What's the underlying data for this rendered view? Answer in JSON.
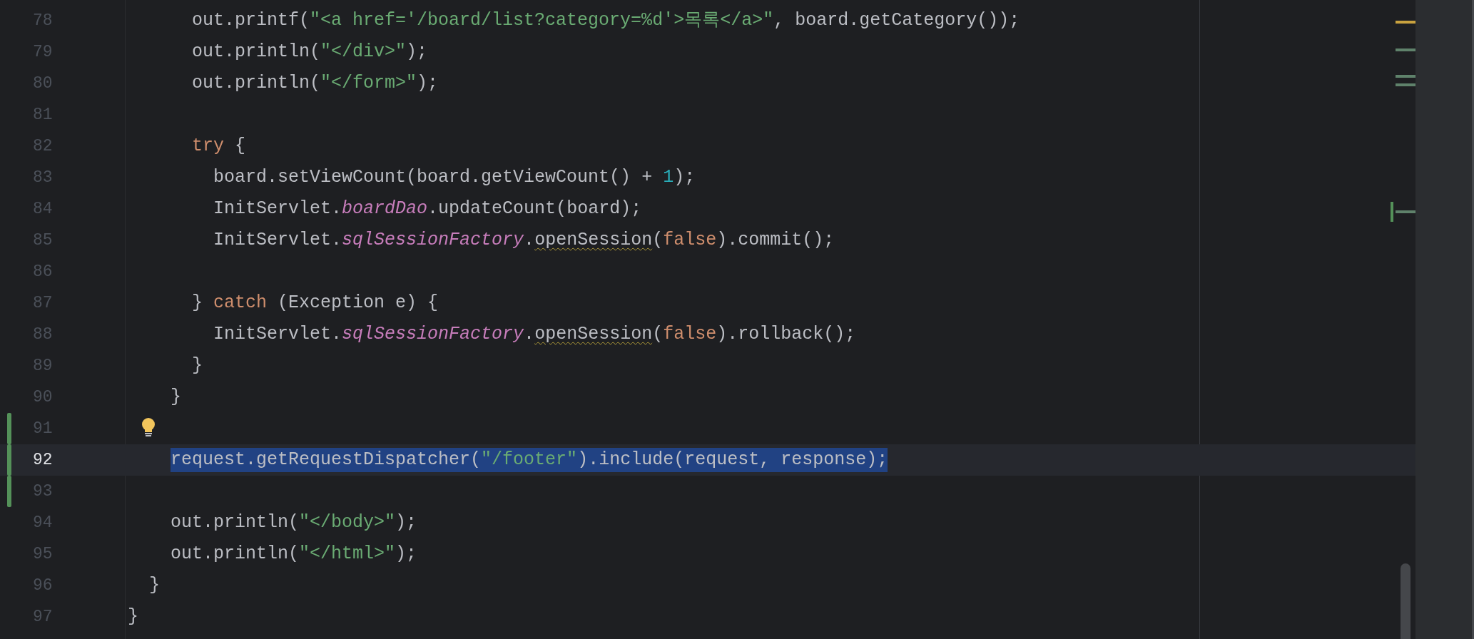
{
  "editor": {
    "lines": [
      {
        "number": "78",
        "changed": false,
        "selected": false,
        "bulb": false,
        "tokens": [
          {
            "kind": "plain",
            "text": "      out.printf("
          },
          {
            "kind": "string",
            "text": "\"<a href='/board/list?category=%d'>목록</a>\""
          },
          {
            "kind": "plain",
            "text": ", board.getCategory());"
          }
        ]
      },
      {
        "number": "79",
        "changed": false,
        "selected": false,
        "bulb": false,
        "tokens": [
          {
            "kind": "plain",
            "text": "      out.println("
          },
          {
            "kind": "string",
            "text": "\"</div>\""
          },
          {
            "kind": "plain",
            "text": ");"
          }
        ]
      },
      {
        "number": "80",
        "changed": false,
        "selected": false,
        "bulb": false,
        "tokens": [
          {
            "kind": "plain",
            "text": "      out.println("
          },
          {
            "kind": "string",
            "text": "\"</form>\""
          },
          {
            "kind": "plain",
            "text": ");"
          }
        ]
      },
      {
        "number": "81",
        "changed": false,
        "selected": false,
        "bulb": false
      },
      {
        "number": "82",
        "changed": false,
        "selected": false,
        "bulb": false,
        "tokens": [
          {
            "kind": "keyword",
            "text": "      try"
          },
          {
            "kind": "plain",
            "text": " {"
          }
        ]
      },
      {
        "number": "83",
        "changed": false,
        "selected": false,
        "bulb": false,
        "tokens": [
          {
            "kind": "plain",
            "text": "        board.setViewCount(board.getViewCount() + "
          },
          {
            "kind": "number",
            "text": "1"
          },
          {
            "kind": "plain",
            "text": ");"
          }
        ]
      },
      {
        "number": "84",
        "changed": false,
        "selected": false,
        "bulb": false,
        "tokens": [
          {
            "kind": "plain",
            "text": "        InitServlet."
          },
          {
            "kind": "field",
            "text": "boardDao"
          },
          {
            "kind": "plain",
            "text": ".updateCount(board);"
          }
        ]
      },
      {
        "number": "85",
        "changed": false,
        "selected": false,
        "bulb": false,
        "tokens": [
          {
            "kind": "plain",
            "text": "        InitServlet."
          },
          {
            "kind": "field",
            "text": "sqlSessionFactory"
          },
          {
            "kind": "plain",
            "text": "."
          },
          {
            "kind": "warning",
            "text": "openSession"
          },
          {
            "kind": "plain",
            "text": "("
          },
          {
            "kind": "keyword",
            "text": "false"
          },
          {
            "kind": "plain",
            "text": ").commit();"
          }
        ]
      },
      {
        "number": "86",
        "changed": false,
        "selected": false,
        "bulb": false
      },
      {
        "number": "87",
        "changed": false,
        "selected": false,
        "bulb": false,
        "tokens": [
          {
            "kind": "plain",
            "text": "      } "
          },
          {
            "kind": "keyword",
            "text": "catch"
          },
          {
            "kind": "plain",
            "text": " (Exception e) {"
          }
        ]
      },
      {
        "number": "88",
        "changed": false,
        "selected": false,
        "bulb": false,
        "tokens": [
          {
            "kind": "plain",
            "text": "        InitServlet."
          },
          {
            "kind": "field",
            "text": "sqlSessionFactory"
          },
          {
            "kind": "plain",
            "text": "."
          },
          {
            "kind": "warning",
            "text": "openSession"
          },
          {
            "kind": "plain",
            "text": "("
          },
          {
            "kind": "keyword",
            "text": "false"
          },
          {
            "kind": "plain",
            "text": ").rollback();"
          }
        ]
      },
      {
        "number": "89",
        "changed": false,
        "selected": false,
        "bulb": false,
        "tokens": [
          {
            "kind": "plain",
            "text": "      }"
          }
        ]
      },
      {
        "number": "90",
        "changed": false,
        "selected": false,
        "bulb": false,
        "tokens": [
          {
            "kind": "plain",
            "text": "    }"
          }
        ]
      },
      {
        "number": "91",
        "changed": true,
        "selected": false,
        "bulb": true
      },
      {
        "number": "92",
        "changed": true,
        "selected": true,
        "bulb": false,
        "tokens": [
          {
            "kind": "plain",
            "text": "    request.getRequestDispatcher("
          },
          {
            "kind": "string",
            "text": "\"/footer\""
          },
          {
            "kind": "plain",
            "text": ").include(request, response);"
          }
        ]
      },
      {
        "number": "93",
        "changed": true,
        "selected": false,
        "bulb": false
      },
      {
        "number": "94",
        "changed": false,
        "selected": false,
        "bulb": false,
        "tokens": [
          {
            "kind": "plain",
            "text": "    out.println("
          },
          {
            "kind": "string",
            "text": "\"</body>\""
          },
          {
            "kind": "plain",
            "text": ");"
          }
        ]
      },
      {
        "number": "95",
        "changed": false,
        "selected": false,
        "bulb": false,
        "tokens": [
          {
            "kind": "plain",
            "text": "    out.println("
          },
          {
            "kind": "string",
            "text": "\"</html>\""
          },
          {
            "kind": "plain",
            "text": ");"
          }
        ]
      },
      {
        "number": "96",
        "changed": false,
        "selected": false,
        "bulb": false,
        "tokens": [
          {
            "kind": "plain",
            "text": "  }"
          }
        ]
      },
      {
        "number": "97",
        "changed": false,
        "selected": false,
        "bulb": false,
        "tokens": [
          {
            "kind": "plain",
            "text": "}"
          }
        ]
      }
    ]
  }
}
